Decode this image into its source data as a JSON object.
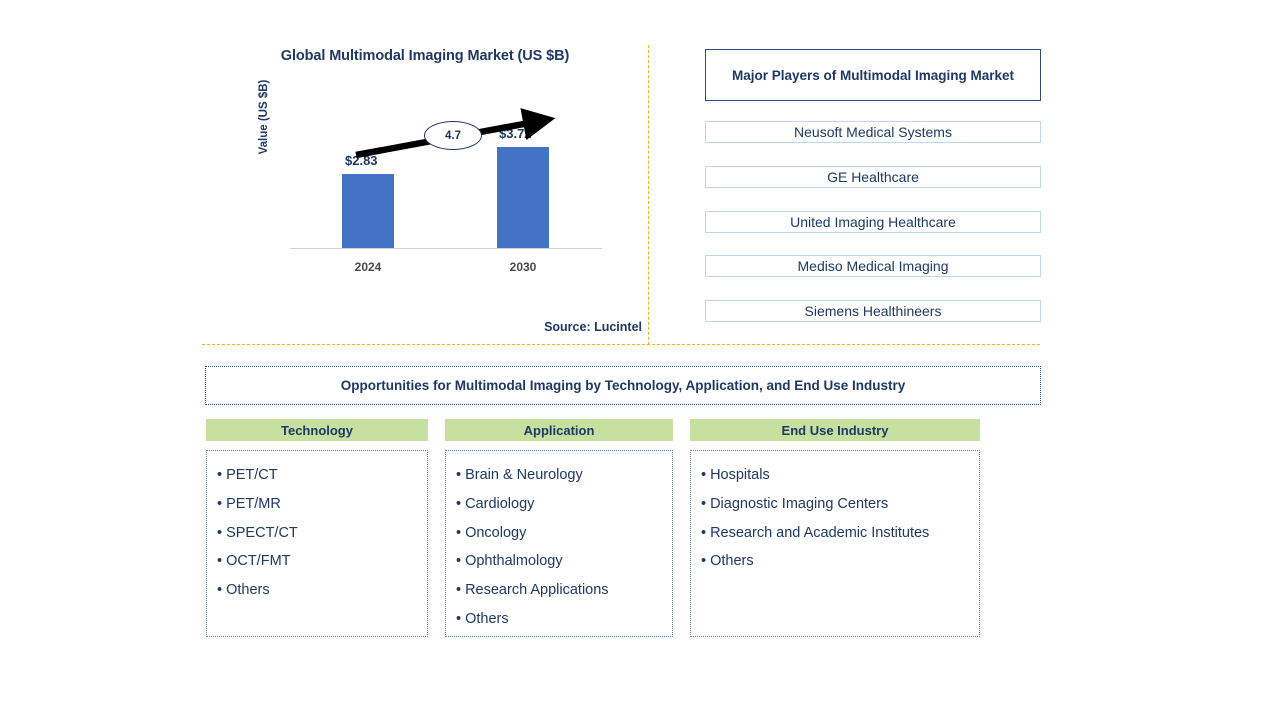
{
  "chart": {
    "title": "Global Multimodal Imaging Market (US $B)",
    "y_axis_label": "Value (US $B)",
    "source": "Source: Lucintel",
    "bar_color": "#4472C4",
    "cagr_label": "4.7"
  },
  "chart_data": {
    "type": "bar",
    "title": "Global Multimodal Imaging Market (US $B)",
    "xlabel": "",
    "ylabel": "Value (US $B)",
    "categories": [
      "2024",
      "2030"
    ],
    "values": [
      2.83,
      3.72
    ],
    "value_labels": [
      "$2.83",
      "$3.72"
    ],
    "ylim": [
      0,
      4.2
    ],
    "grid": false,
    "legend": "none",
    "annotations": [
      {
        "text": "4.7",
        "meaning": "CAGR percent between 2024 and 2030",
        "shape": "ellipse"
      }
    ],
    "source": "Source: Lucintel"
  },
  "players": {
    "header": "Major Players of Multimodal Imaging Market",
    "items": [
      "Neusoft Medical Systems",
      "GE Healthcare",
      "United Imaging Healthcare",
      "Mediso Medical Imaging",
      "Siemens Healthineers"
    ]
  },
  "opportunities": {
    "banner": "Opportunities for Multimodal Imaging by Technology, Application, and End Use Industry",
    "columns": [
      {
        "header": "Technology",
        "items": [
          "PET/CT",
          "PET/MR",
          "SPECT/CT",
          "OCT/FMT",
          "Others"
        ]
      },
      {
        "header": "Application",
        "items": [
          "Brain & Neurology",
          "Cardiology",
          "Oncology",
          "Ophthalmology",
          "Research Applications",
          "Others"
        ]
      },
      {
        "header": "End Use Industry",
        "items": [
          "Hospitals",
          "Diagnostic Imaging Centers",
          "Research and Academic Institutes",
          "Others"
        ]
      }
    ],
    "header_color": "#C6E0A0"
  }
}
